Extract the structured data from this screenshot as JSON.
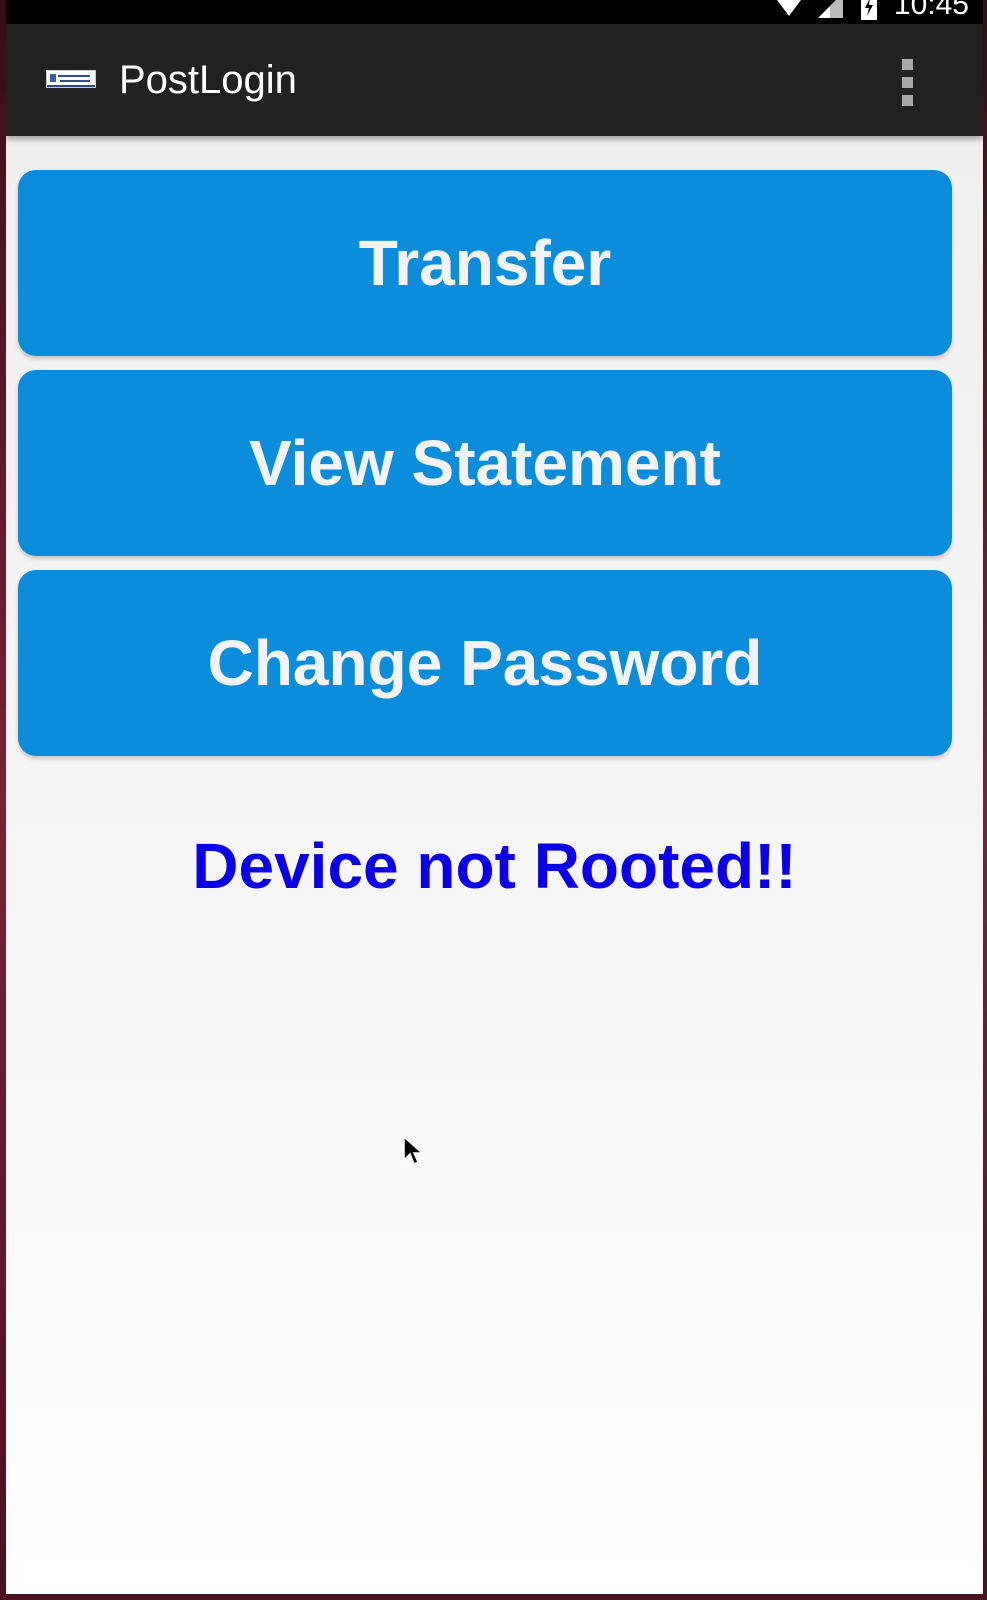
{
  "status_bar": {
    "time": "10:45",
    "icons": [
      "wifi-icon",
      "signal-icon",
      "battery-icon"
    ]
  },
  "app_bar": {
    "title": "PostLogin",
    "logo_icon": "app-logo-icon",
    "overflow_icon": "overflow-menu-icon",
    "background": "#212121"
  },
  "actions": {
    "transfer_label": "Transfer",
    "view_statement_label": "View Statement",
    "change_password_label": "Change Password",
    "button_color": "#0b8ddb"
  },
  "status": {
    "message": "Device not Rooted!!",
    "color": "#0b00e6"
  }
}
